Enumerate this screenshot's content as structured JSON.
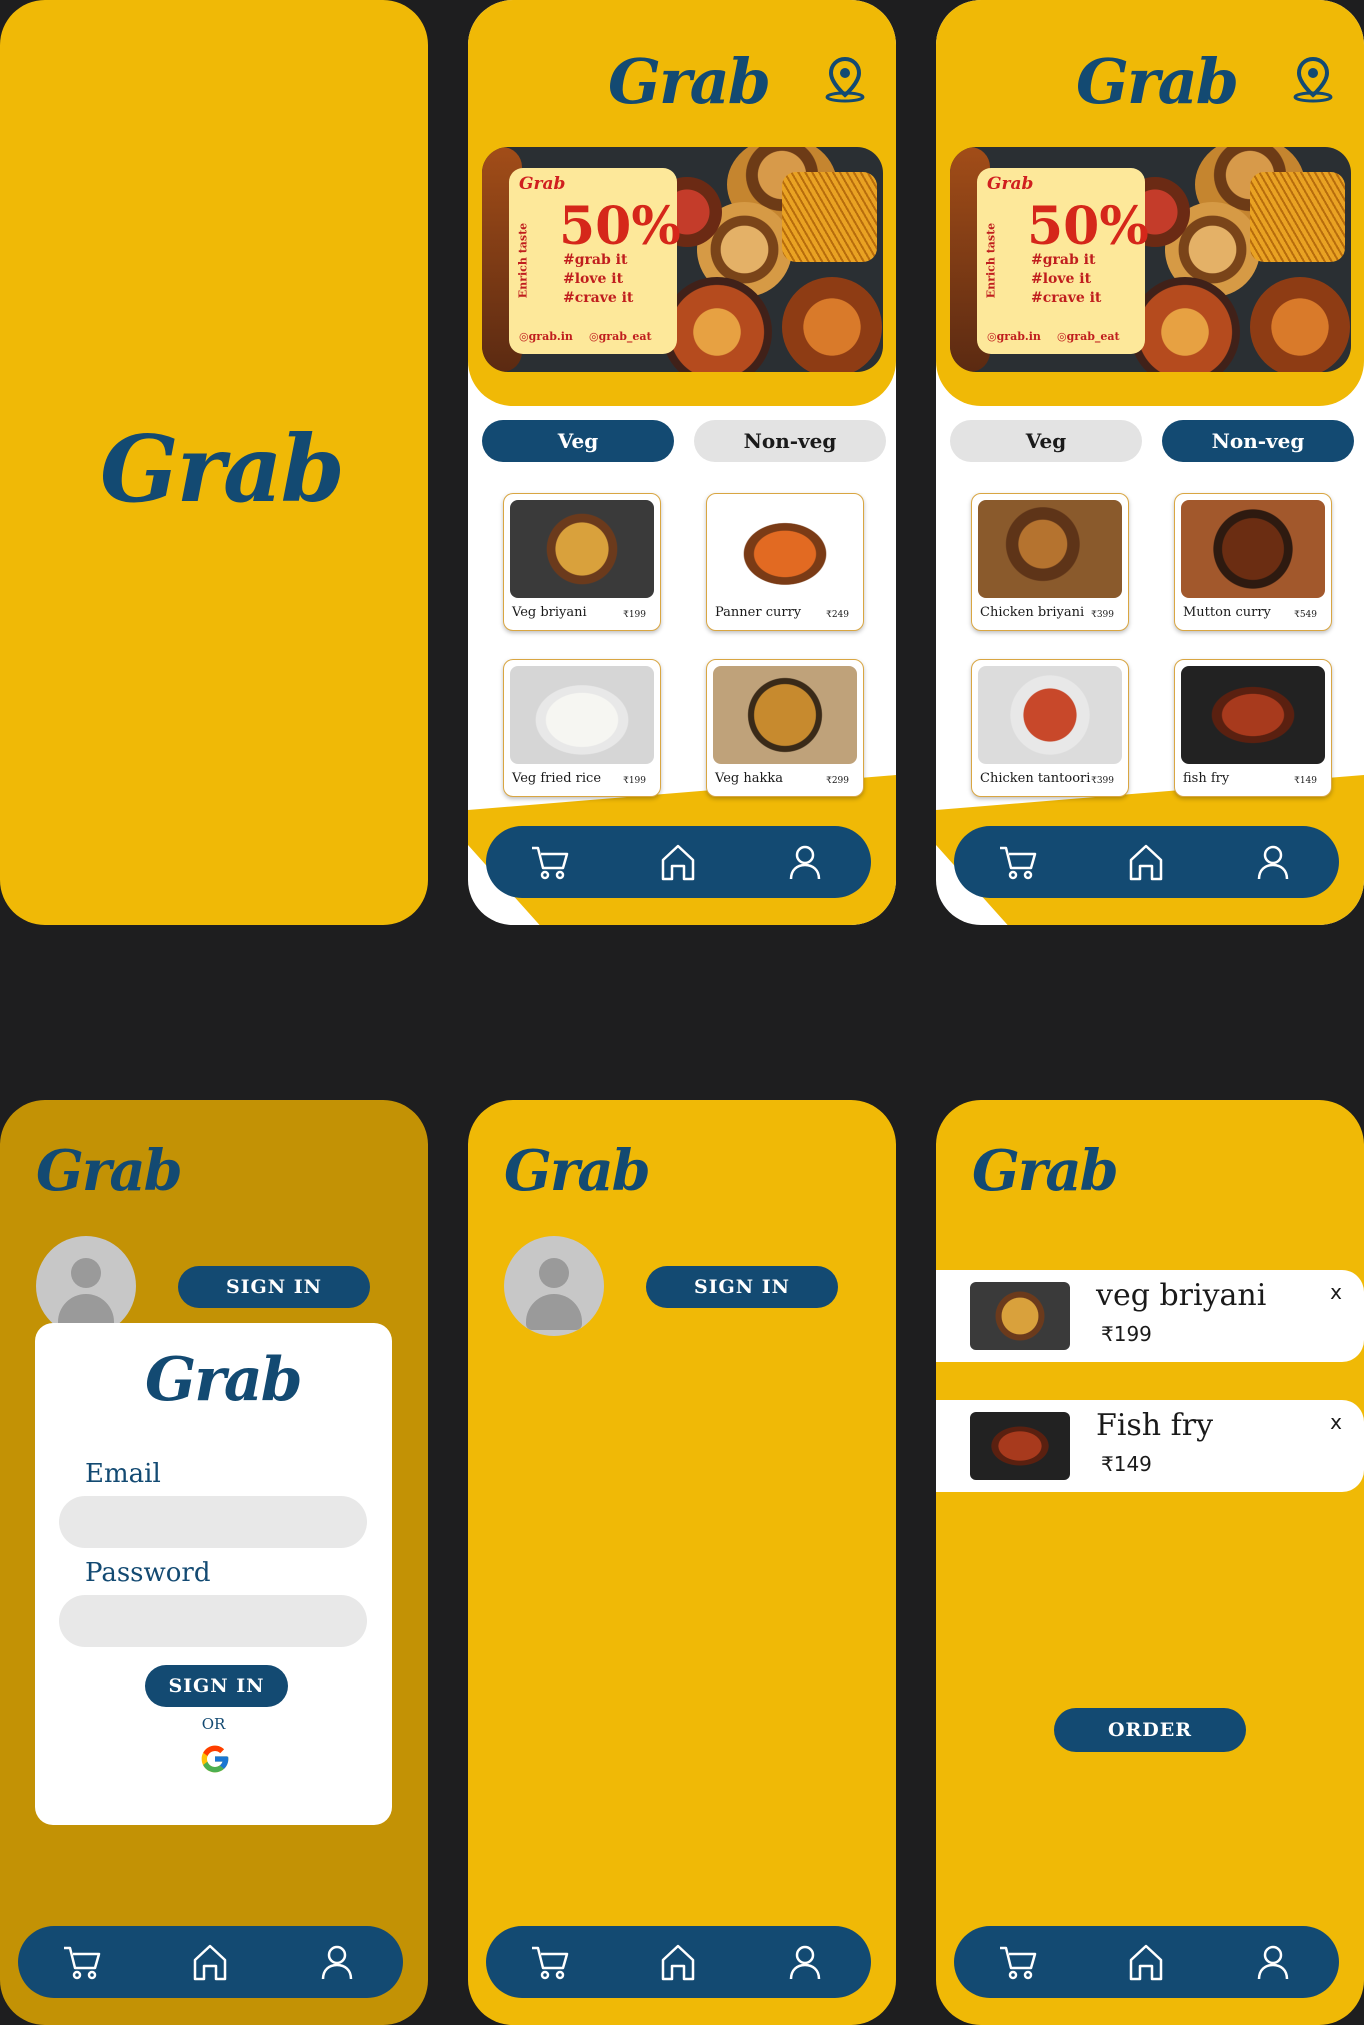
{
  "brand": {
    "name": "Grab",
    "primary": "#134a72",
    "accent": "#f0b906"
  },
  "promo": {
    "brand": "Grab",
    "tagline": "Enrich taste",
    "discount": "50%",
    "tags": [
      "#grab it",
      "#love it",
      "#crave it"
    ],
    "web": "grab.in",
    "social": "grab_eat"
  },
  "tabs": {
    "veg": "Veg",
    "nonveg": "Non-veg"
  },
  "veg_menu": [
    {
      "name": "Veg briyani",
      "price": "₹199"
    },
    {
      "name": "Panner curry",
      "price": "₹249"
    },
    {
      "name": "Veg fried rice",
      "price": "₹199"
    },
    {
      "name": "Veg  hakka",
      "price": "₹299"
    }
  ],
  "nonveg_menu": [
    {
      "name": "Chicken briyani",
      "price": "₹399"
    },
    {
      "name": "Mutton curry",
      "price": "₹549"
    },
    {
      "name": "Chicken tantoori",
      "price": "₹399"
    },
    {
      "name": "fish fry",
      "price": "₹149"
    }
  ],
  "profile": {
    "signin": "SIGN IN"
  },
  "login": {
    "email_label": "Email",
    "password_label": "Password",
    "email_value": "",
    "password_value": "",
    "signin": "SIGN IN",
    "or": "OR"
  },
  "cart": {
    "items": [
      {
        "name": "veg briyani",
        "price": "₹199",
        "remove": "x"
      },
      {
        "name": "Fish fry",
        "price": "₹149",
        "remove": "x"
      }
    ],
    "order": "ORDER"
  },
  "icons": {
    "location": "location-pin-icon",
    "cart": "cart-icon",
    "home": "home-icon",
    "user": "user-icon",
    "google": "google-icon"
  }
}
